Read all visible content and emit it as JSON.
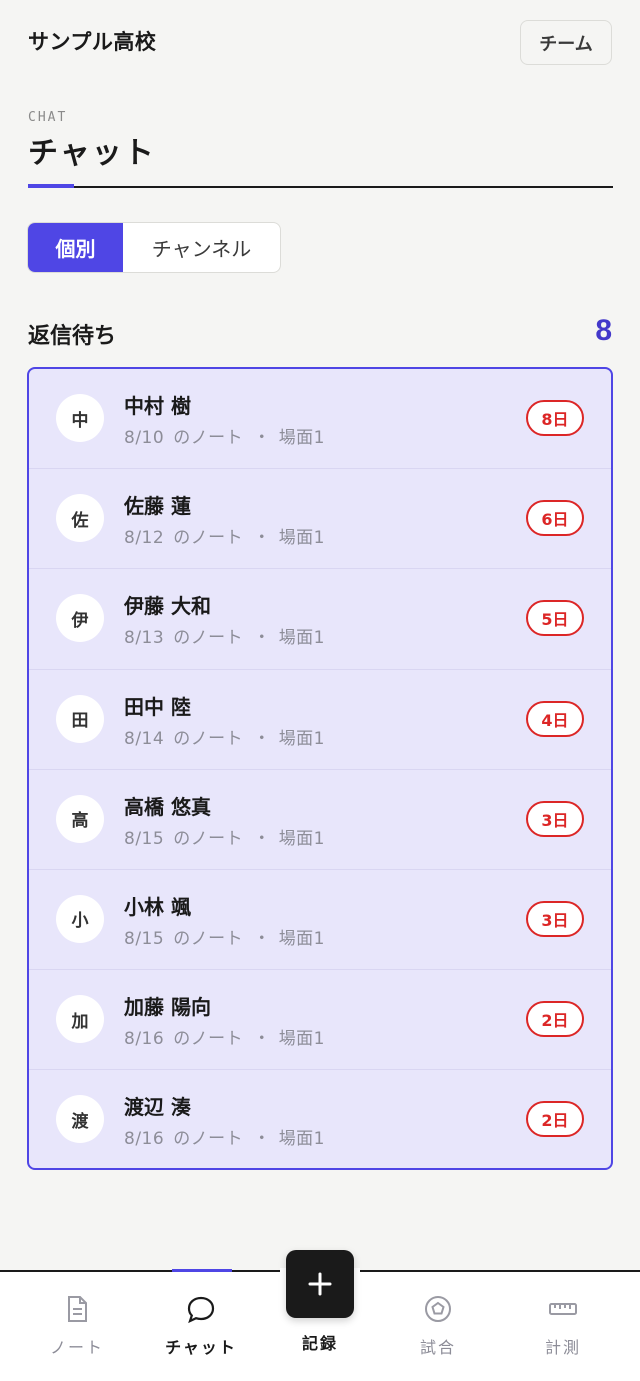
{
  "header": {
    "school_name": "サンプル高校",
    "team_button": "チーム"
  },
  "page": {
    "eyebrow": "CHAT",
    "title": "チャット"
  },
  "segment": {
    "individual": "個別",
    "channel": "チャンネル",
    "selected": "個別"
  },
  "section": {
    "title": "返信待ち",
    "count": "8"
  },
  "colors": {
    "accent": "#4f46e5",
    "alert": "#dc2626",
    "list_bg": "#e8e6fb"
  },
  "pending": [
    {
      "initial": "中",
      "name": "中村 樹",
      "date": "8/10",
      "note": "のノート",
      "sep": "・",
      "scene": "場面1",
      "badge": "8日"
    },
    {
      "initial": "佐",
      "name": "佐藤 蓮",
      "date": "8/12",
      "note": "のノート",
      "sep": "・",
      "scene": "場面1",
      "badge": "6日"
    },
    {
      "initial": "伊",
      "name": "伊藤 大和",
      "date": "8/13",
      "note": "のノート",
      "sep": "・",
      "scene": "場面1",
      "badge": "5日"
    },
    {
      "initial": "田",
      "name": "田中 陸",
      "date": "8/14",
      "note": "のノート",
      "sep": "・",
      "scene": "場面1",
      "badge": "4日"
    },
    {
      "initial": "高",
      "name": "高橋 悠真",
      "date": "8/15",
      "note": "のノート",
      "sep": "・",
      "scene": "場面1",
      "badge": "3日"
    },
    {
      "initial": "小",
      "name": "小林 颯",
      "date": "8/15",
      "note": "のノート",
      "sep": "・",
      "scene": "場面1",
      "badge": "3日"
    },
    {
      "initial": "加",
      "name": "加藤 陽向",
      "date": "8/16",
      "note": "のノート",
      "sep": "・",
      "scene": "場面1",
      "badge": "2日"
    },
    {
      "initial": "渡",
      "name": "渡辺 湊",
      "date": "8/16",
      "note": "のノート",
      "sep": "・",
      "scene": "場面1",
      "badge": "2日"
    }
  ],
  "tabbar": {
    "note": {
      "label": "ノート",
      "icon": "document-icon"
    },
    "chat": {
      "label": "チャット",
      "icon": "chat-bubble-icon"
    },
    "record": {
      "label": "記録",
      "icon": "plus-icon"
    },
    "match": {
      "label": "試合",
      "icon": "pentagon-ball-icon"
    },
    "measure": {
      "label": "計測",
      "icon": "ruler-icon"
    },
    "active": "chat"
  }
}
